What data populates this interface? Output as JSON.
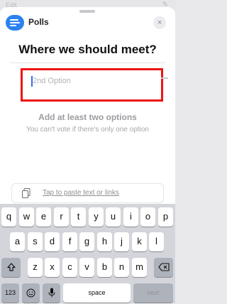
{
  "background": {
    "left_text": "Edit"
  },
  "header": {
    "app_name": "Polls",
    "close_label": "×"
  },
  "poll": {
    "question": "Where we should meet?",
    "option_placeholder": "2nd Option"
  },
  "hint": {
    "title": "Add at least two options",
    "subtitle": "You can't vote if there's only one option"
  },
  "paste": {
    "label": "Tap to paste text or links"
  },
  "keyboard": {
    "row1": [
      "q",
      "w",
      "e",
      "r",
      "t",
      "y",
      "u",
      "i",
      "o",
      "p"
    ],
    "row2": [
      "a",
      "s",
      "d",
      "f",
      "g",
      "h",
      "j",
      "k",
      "l"
    ],
    "row3": [
      "z",
      "x",
      "c",
      "v",
      "b",
      "n",
      "m"
    ],
    "numbers_label": "123",
    "space_label": "space",
    "next_label": "next"
  },
  "colors": {
    "highlight": "#ef1414",
    "accent": "#2d82f0"
  }
}
